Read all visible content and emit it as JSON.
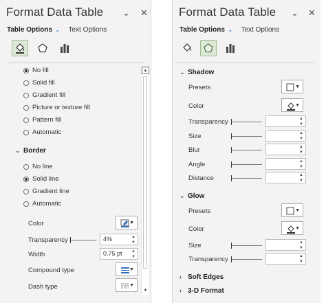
{
  "left_pane": {
    "title": "Format Data Table",
    "collapse_glyph": "⌄",
    "close_glyph": "✕",
    "options_active": "Table Options",
    "options_chevron": "⌄",
    "options_inactive": "Text Options",
    "fill_options": [
      "No fill",
      "Solid fill",
      "Gradient fill",
      "Picture or texture fill",
      "Pattern fill",
      "Automatic"
    ],
    "fill_selected": "No fill",
    "border_section": "Border",
    "border_options": [
      "No line",
      "Solid line",
      "Gradient line",
      "Automatic"
    ],
    "border_selected": "Solid line",
    "color_label": "Color",
    "transparency_label": "Transparency",
    "transparency_value": "4%",
    "transparency_level": 0.04,
    "width_label": "Width",
    "width_value": "0.75 pt",
    "compound_label": "Compound type",
    "dash_label": "Dash type"
  },
  "right_pane": {
    "title": "Format Data Table",
    "collapse_glyph": "⌄",
    "close_glyph": "✕",
    "options_active": "Table Options",
    "options_chevron": "⌄",
    "options_inactive": "Text Options",
    "shadow_section": "Shadow",
    "shadow_presets_label": "Presets",
    "shadow_color_label": "Color",
    "shadow_fields": [
      "Transparency",
      "Size",
      "Blur",
      "Angle",
      "Distance"
    ],
    "glow_section": "Glow",
    "glow_presets_label": "Presets",
    "glow_color_label": "Color",
    "glow_fields": [
      "Size",
      "Transparency"
    ],
    "soft_edges_section": "Soft Edges",
    "three_d_section": "3-D Format"
  },
  "colors": {
    "accent": "#2f6fba",
    "selected_tab_bg": "#dfe7d9",
    "pane_bg": "#f3f3f3"
  },
  "icons": {
    "fill": "paint-bucket-icon",
    "effects": "pentagon-icon",
    "size": "bar-chart-icon"
  }
}
